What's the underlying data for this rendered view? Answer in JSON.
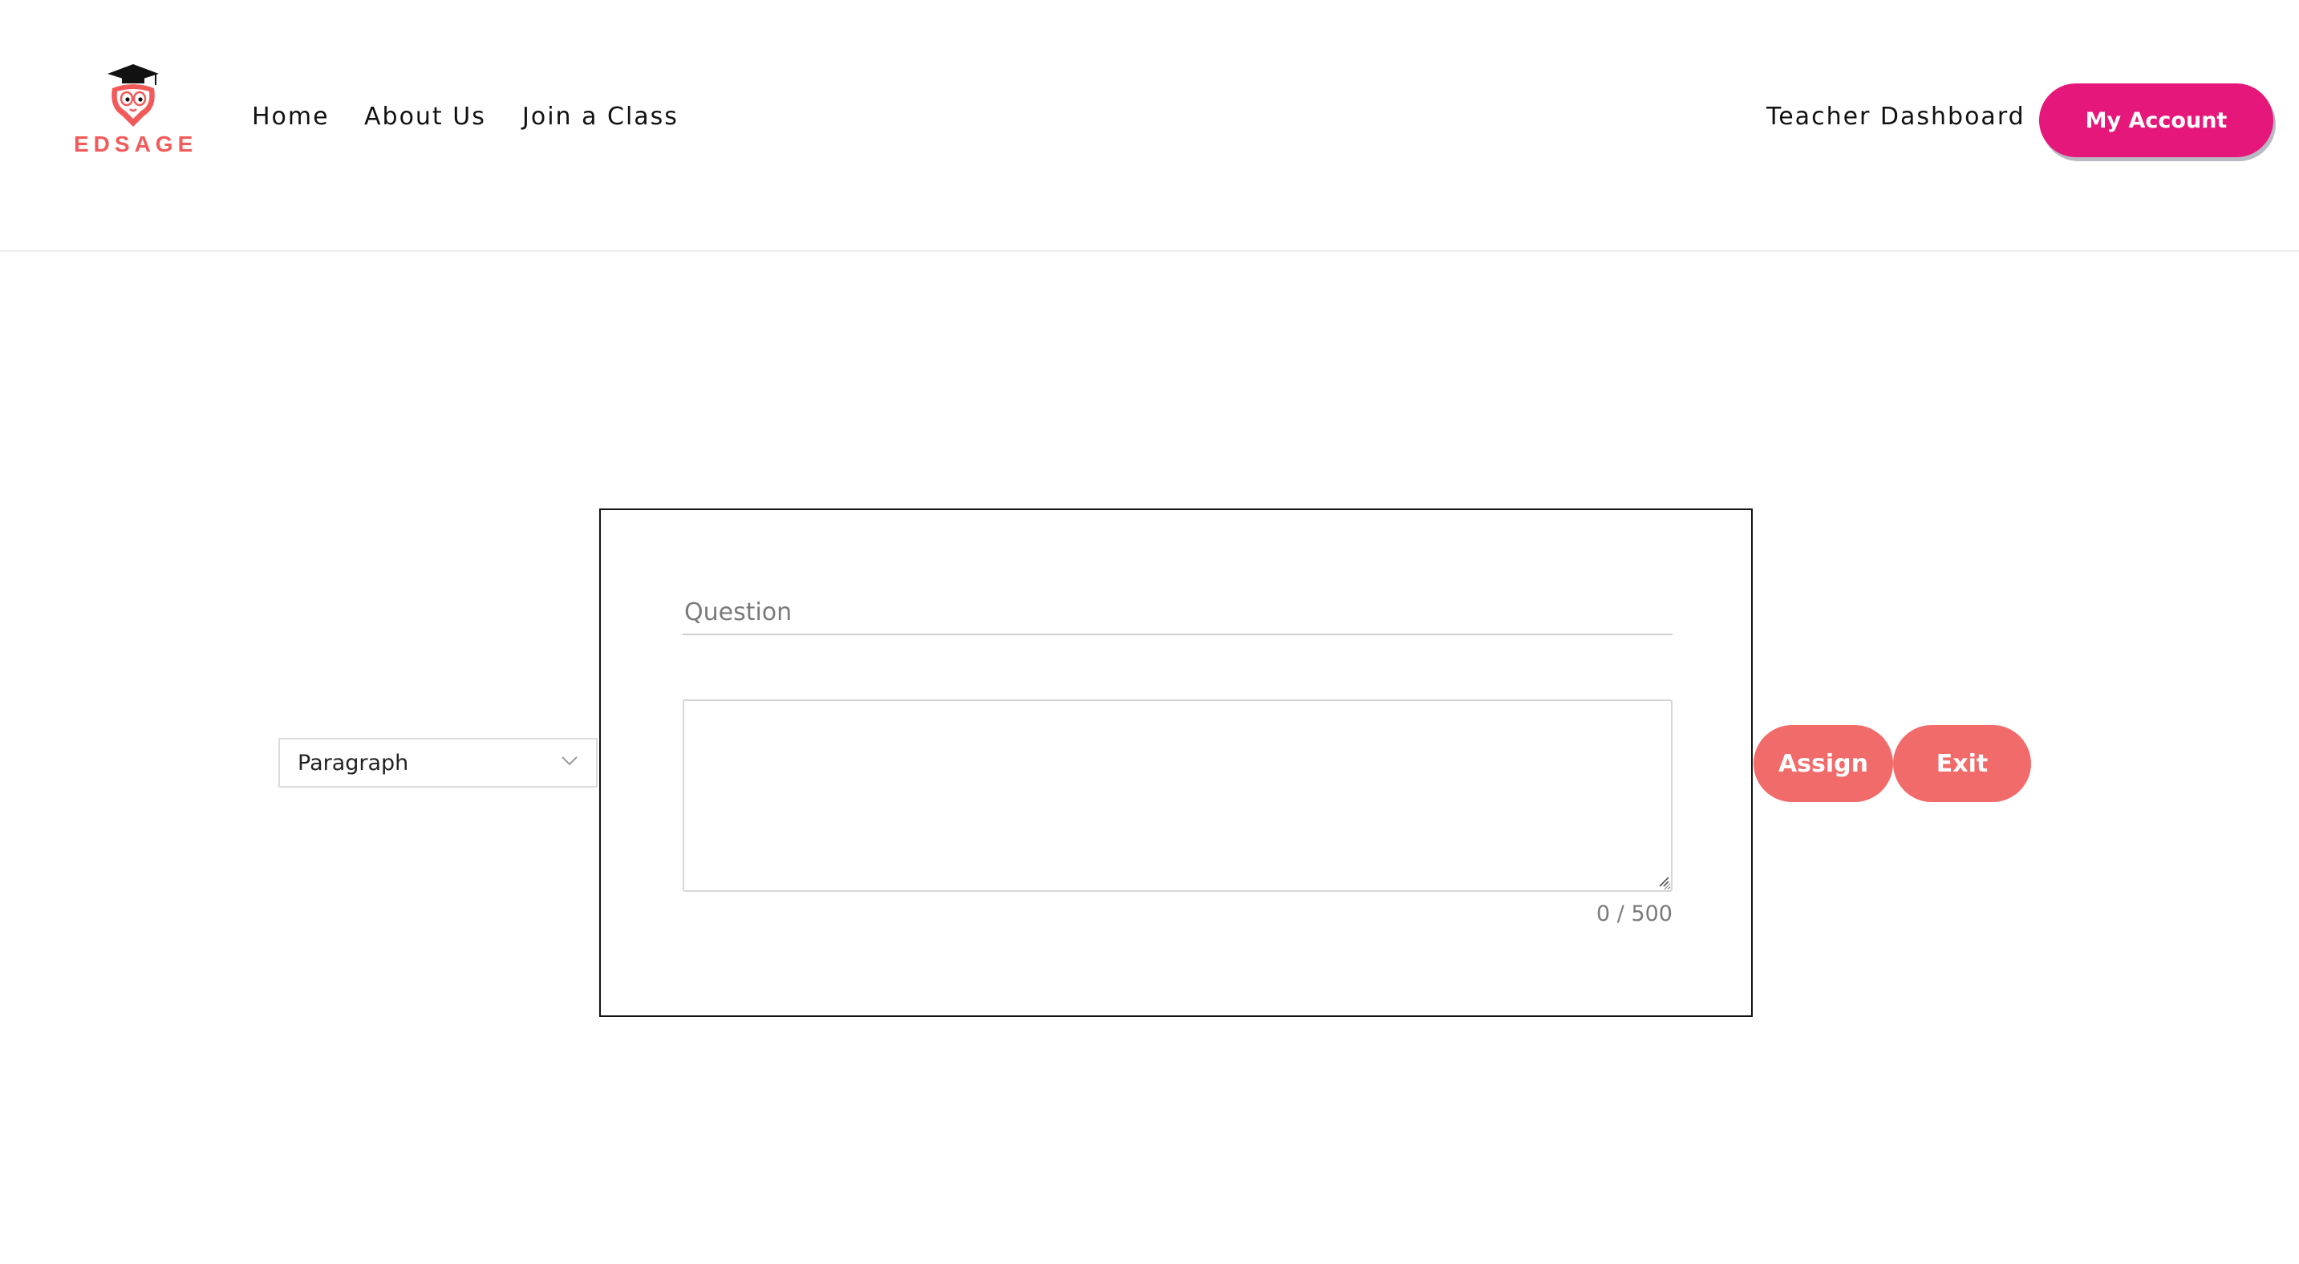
{
  "header": {
    "logo_text": "EDSAGE",
    "nav": {
      "home": "Home",
      "about": "About Us",
      "join": "Join a Class"
    },
    "teacher_dashboard": "Teacher Dashboard",
    "my_account": "My Account"
  },
  "editor": {
    "type_select": {
      "selected": "Paragraph"
    },
    "question": {
      "placeholder": "Question",
      "value": ""
    },
    "answer": {
      "value": "",
      "char_count": "0 / 500"
    },
    "actions": {
      "assign": "Assign",
      "exit": "Exit"
    }
  },
  "colors": {
    "brand_red": "#f25a5a",
    "account_pink": "#e6177a",
    "action_coral": "#f26b6b"
  },
  "icons": {
    "logo": "graduation-owl-logo-icon",
    "select": "chevron-down-icon",
    "textarea": "resize-handle-icon"
  }
}
